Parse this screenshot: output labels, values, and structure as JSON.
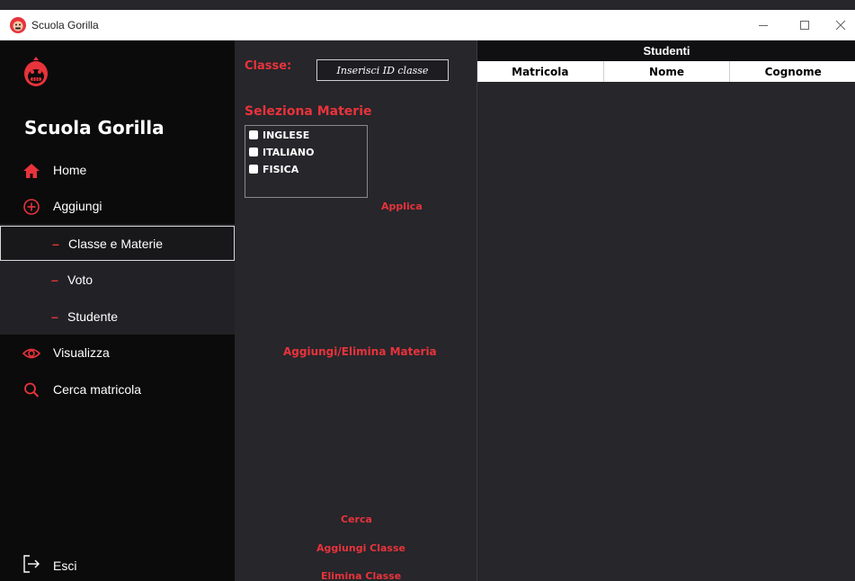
{
  "window": {
    "title": "Scuola Gorilla"
  },
  "sidebar": {
    "brand": "Scuola Gorilla",
    "items": [
      {
        "label": "Home",
        "icon": "home-icon"
      },
      {
        "label": "Aggiungi",
        "icon": "plus-circle-icon"
      },
      {
        "label": "Visualizza",
        "icon": "eye-icon"
      },
      {
        "label": "Cerca matricola",
        "icon": "search-icon"
      }
    ],
    "subitems": [
      {
        "label": "Classe e Materie",
        "active": true
      },
      {
        "label": "Voto"
      },
      {
        "label": "Studente"
      }
    ],
    "exit": {
      "label": "Esci",
      "icon": "logout-icon"
    }
  },
  "form": {
    "class_label": "Classe:",
    "class_placeholder": "Inserisci ID classe",
    "subjects_title": "Seleziona Materie",
    "subjects": [
      "INGLESE",
      "ITALIANO",
      "FISICA"
    ],
    "apply": "Applica",
    "add_remove_subject": "Aggiungi/Elimina Materia",
    "search": "Cerca",
    "add_class": "Aggiungi Classe",
    "remove_class": "Elimina Classe"
  },
  "students": {
    "title": "Studenti",
    "columns": [
      "Matricola",
      "Nome",
      "Cognome"
    ]
  },
  "colors": {
    "accent": "#e8333b",
    "sidebar": "#0b0b0b",
    "submenu": "#222226",
    "panel": "#26262b"
  }
}
